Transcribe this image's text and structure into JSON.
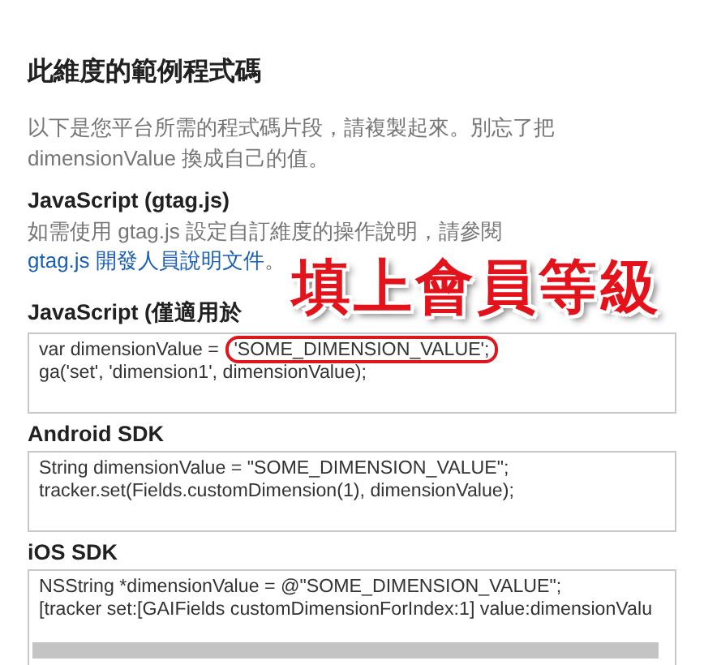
{
  "section_title": "此維度的範例程式碼",
  "intro": "以下是您平台所需的程式碼片段，請複製起來。別忘了把 dimensionValue 換成自己的值。",
  "snippets": [
    {
      "kind": "note",
      "heading": "JavaScript (gtag.js)",
      "text": "如需使用 gtag.js 設定自訂維度的操作說明，請參閱 ",
      "link": "gtag.js 開發人員說明文件",
      "after": "。"
    },
    {
      "kind": "code",
      "heading": "JavaScript (僅適用於",
      "lines": [
        {
          "text": "var dimensionValue = ",
          "highlight": "'SOME_DIMENSION_VALUE';"
        },
        {
          "text": "ga('set', 'dimension1', dimensionValue);"
        }
      ],
      "scrollbar": false
    },
    {
      "kind": "code",
      "heading": "Android SDK",
      "lines": [
        {
          "text": "String dimensionValue = \"SOME_DIMENSION_VALUE\";"
        },
        {
          "text": "tracker.set(Fields.customDimension(1), dimensionValue);"
        }
      ],
      "scrollbar": false
    },
    {
      "kind": "code",
      "heading": "iOS SDK",
      "lines": [
        {
          "text": "NSString *dimensionValue = @\"SOME_DIMENSION_VALUE\";"
        },
        {
          "text": "[tracker set:[GAIFields customDimensionForIndex:1] value:dimensionValu"
        }
      ],
      "scrollbar": true
    }
  ],
  "annotation": {
    "text": "填上會員等級"
  }
}
